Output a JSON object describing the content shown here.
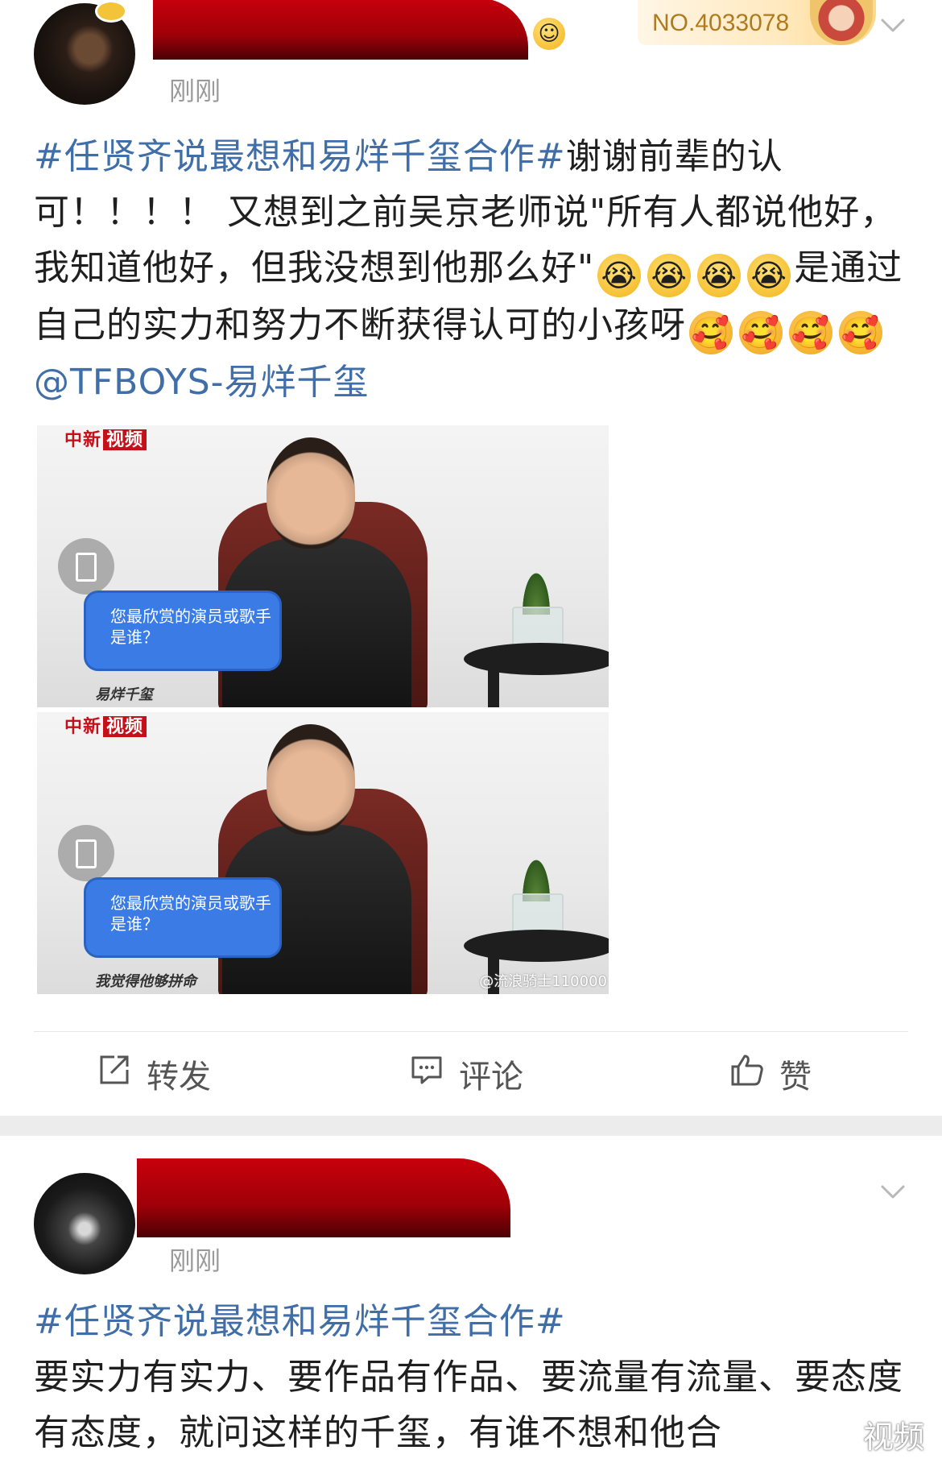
{
  "post1": {
    "fans_badge": {
      "number": "NO.4033078"
    },
    "timestamp": "刚刚",
    "content": {
      "tag": "#任贤齐说最想和易烊千玺合作#",
      "text_1": "谢谢前辈的认可！！！！ 又想到之前吴京老师说\"所有人都说他好，我知道他好，但我没想到他那么好\"",
      "text_2": "是通过自己的实力和努力不断获得认可的小孩呀",
      "mention": "@TFBOYS-易烊千玺",
      "emojis": [
        "crying-face",
        "crying-face",
        "crying-face",
        "crying-face",
        "love-hug-face",
        "love-hug-face",
        "love-hug-face",
        "love-hug-face"
      ]
    },
    "media": [
      {
        "logo_text": "中新",
        "logo_box": "视频",
        "question": "您最欣赏的演员或歌手是谁？",
        "subtitle": "易烊千玺"
      },
      {
        "logo_text": "中新",
        "logo_box": "视频",
        "question": "您最欣赏的演员或歌手是谁？",
        "subtitle": "我觉得他够拼命",
        "watermark": "@流浪骑士110000"
      }
    ],
    "actions": {
      "repost": "转发",
      "comment": "评论",
      "like": "赞"
    }
  },
  "post2": {
    "timestamp": "刚刚",
    "content": {
      "tag": "#任贤齐说最想和易烊千玺合作#",
      "text": "要实力有实力、要作品有作品、要流量有流量、要态度有态度，就问这样的千玺，有谁不想和他合"
    }
  },
  "watermark": "视频",
  "colors": {
    "link_blue": "#3f6ea8",
    "redaction_red": "#b00009",
    "badge_gold": "#b07a1e",
    "separator_gray": "#ececec"
  }
}
